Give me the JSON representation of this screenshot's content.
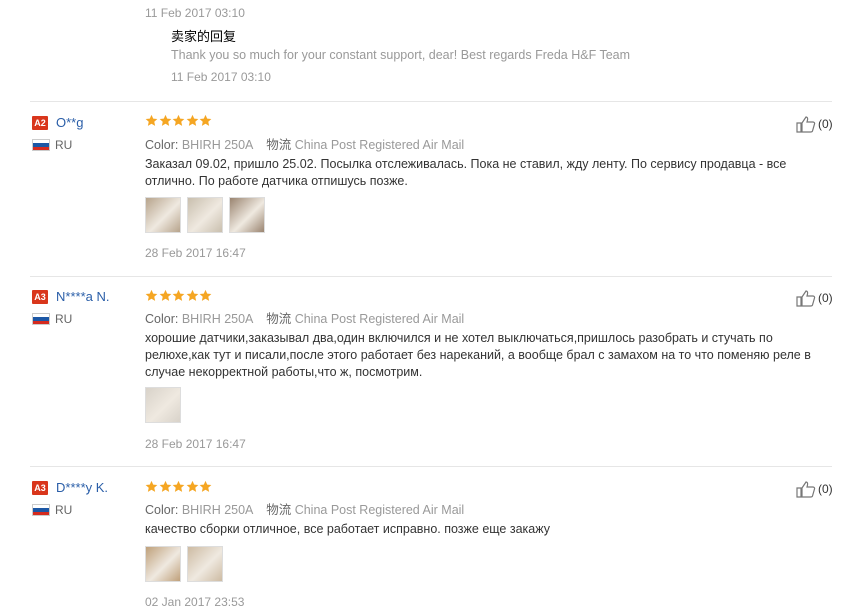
{
  "previous_reply": {
    "feedback_time": "11 Feb 2017 03:10",
    "seller_reply_title": "卖家的回复",
    "seller_reply_text": "Thank you so much for your constant support, dear! Best regards Freda H&F Team",
    "seller_reply_time": "11 Feb 2017 03:10"
  },
  "labels": {
    "color_label": "Color:",
    "shipping_label": "物流"
  },
  "reviews": [
    {
      "level": "A2",
      "user": "O**g",
      "country": "RU",
      "rating": 5,
      "color": "BHIRH 250A",
      "shipping": "China Post Registered Air Mail",
      "text": "Заказал 09.02, пришло 25.02. Посылка отслеживалась. Пока не ставил, жду ленту. По сервису продавца - все отлично. По работе датчика отпишусь позже.",
      "photos": [
        "#b7a48c",
        "#c9bfae",
        "#9a8470"
      ],
      "time": "28 Feb 2017 16:47",
      "useful": "(0)"
    },
    {
      "level": "A3",
      "user": "N****a N.",
      "country": "RU",
      "rating": 5,
      "color": "BHIRH 250A",
      "shipping": "China Post Registered Air Mail",
      "text": "хорошие датчики,заказывал два,один включился и не хотел выключаться,пришлось разобрать и стучать по релюхе,как тут и писали,после этого работает без нареканий, а вообще брал с замахом на то что поменяю реле в случае некорректной работы,что ж, посмотрим.",
      "photos": [
        "#d8d2c9"
      ],
      "time": "28 Feb 2017 16:47",
      "useful": "(0)"
    },
    {
      "level": "A3",
      "user": "D****y K.",
      "country": "RU",
      "rating": 5,
      "color": "BHIRH 250A",
      "shipping": "China Post Registered Air Mail",
      "text": "качество сборки отличное, все работает исправно. позже еще закажу",
      "photos": [
        "#bfa07a",
        "#cdbba3"
      ],
      "time": "02 Jan 2017 23:53",
      "useful": "(0)"
    }
  ],
  "colors": {
    "level_badge": "#d9361c",
    "user_link": "#2a5ea8",
    "star": "#f5a623",
    "muted_text": "#999999"
  },
  "icons": {
    "star": "star-icon",
    "thumbs_up": "thumbs-up-icon",
    "flag": "russia-flag-icon"
  }
}
